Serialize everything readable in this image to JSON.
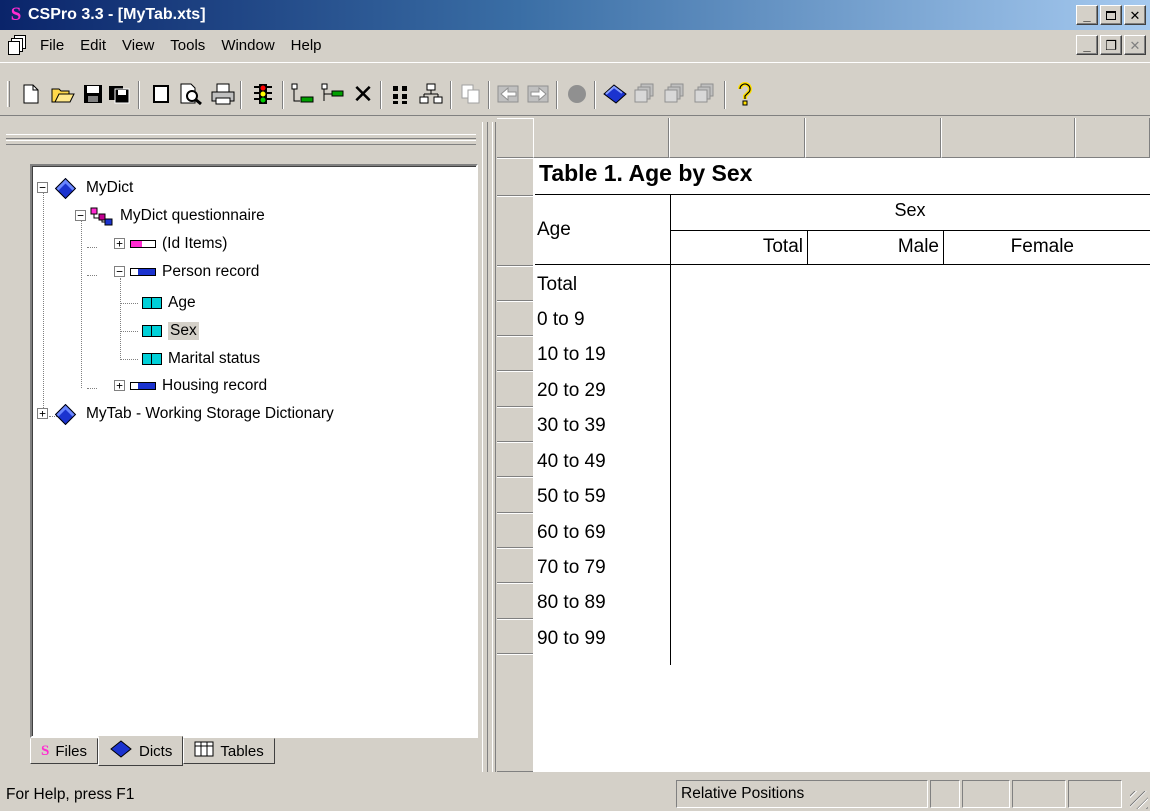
{
  "window": {
    "title": "CSPro 3.3 - [MyTab.xts]",
    "app_icon_glyph": "S"
  },
  "menu": {
    "items": [
      "File",
      "Edit",
      "View",
      "Tools",
      "Window",
      "Help"
    ]
  },
  "toolbar": {
    "buttons": [
      "new-file-icon",
      "open-folder-icon",
      "save-icon",
      "save-all-icon",
      "blank-page-icon",
      "print-preview-icon",
      "print-icon",
      "traffic-light-icon",
      "add-variable-icon",
      "tree-insert-icon",
      "delete-icon",
      "grid-icon",
      "hierarchy-icon",
      "copy-icon",
      "back-icon",
      "forward-icon",
      "stop-icon",
      "dictionary-icon",
      "stack-icon",
      "stack2-icon",
      "stack3-icon",
      "help-icon"
    ]
  },
  "tree": {
    "dict": "MyDict",
    "questionnaire": "MyDict questionnaire",
    "id_items": "(Id Items)",
    "person_record": "Person record",
    "age": "Age",
    "sex": "Sex",
    "marital": "Marital status",
    "housing": "Housing record",
    "working": "MyTab - Working Storage Dictionary"
  },
  "tabs": [
    "Files",
    "Dicts",
    "Tables"
  ],
  "table": {
    "title": "Table 1. Age by Sex",
    "stub_header": "Age",
    "spanner": "Sex",
    "columns": [
      "Total",
      "Male",
      "Female"
    ],
    "rows": [
      "Total",
      "0 to 9",
      "10 to 19",
      "20 to 29",
      "30 to 39",
      "40 to 49",
      "50 to 59",
      "60 to 69",
      "70 to 79",
      "80 to 89",
      "90 to 99"
    ]
  },
  "status": {
    "help": "For Help, press F1",
    "mode": "Relative Positions"
  },
  "colors": {
    "title_start": "#0a246a",
    "title_end": "#a6caf0",
    "face": "#d4d0c8",
    "item_icon": "#00d0d8",
    "dict_icon": "#1b33cf"
  }
}
